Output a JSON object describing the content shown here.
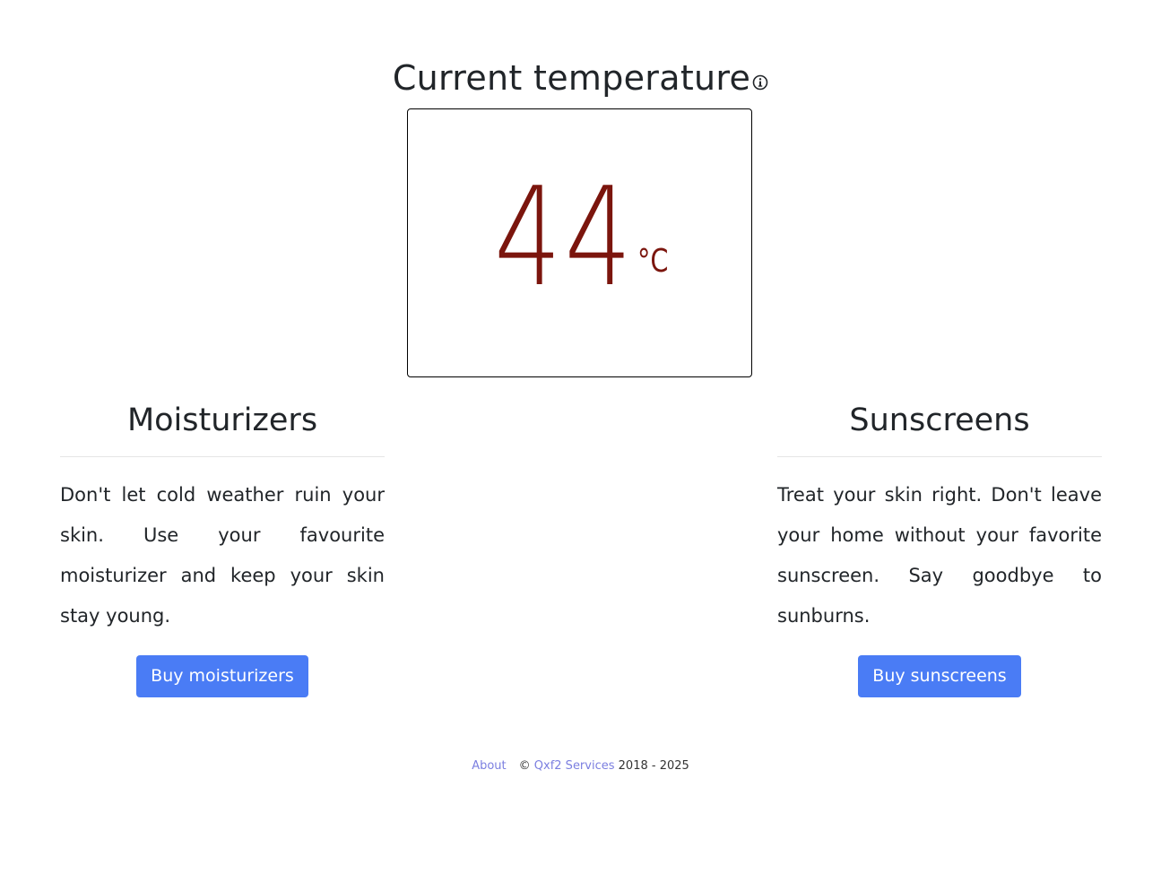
{
  "temperature": {
    "heading": "Current temperature",
    "value": "44",
    "unit": "°C",
    "info_icon": "info-circle-icon",
    "value_color": "#7b150d"
  },
  "moisturizers": {
    "title": "Moisturizers",
    "description": "Don't let cold weather ruin your skin. Use your favourite moisturizer and keep your skin stay young.",
    "button_label": "Buy moisturizers"
  },
  "sunscreens": {
    "title": "Sunscreens",
    "description": "Treat your skin right. Don't leave your home without your favorite sunscreen. Say goodbye to sunburns.",
    "button_label": "Buy sunscreens"
  },
  "footer": {
    "about_label": "About",
    "copyright_symbol": "©",
    "company_label": "Qxf2 Services",
    "years": "2018 - 2025"
  },
  "colors": {
    "button": "#4a7cf5",
    "link": "#7b7fe0"
  }
}
